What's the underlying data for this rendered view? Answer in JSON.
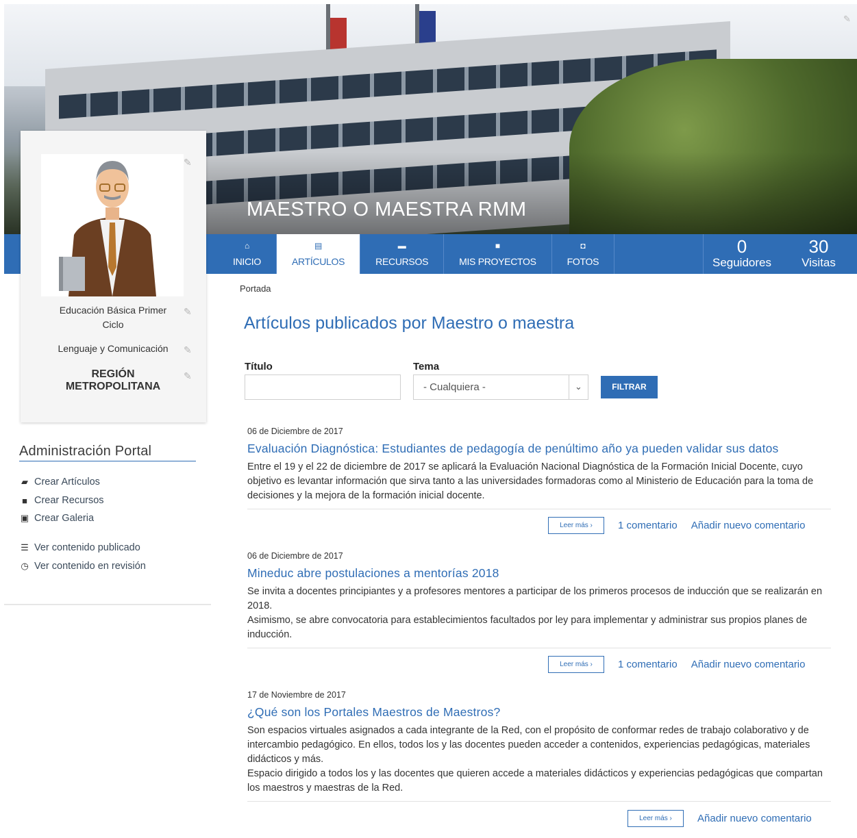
{
  "banner": {
    "title": "MAESTRO O MAESTRA RMM"
  },
  "nav": {
    "tabs": [
      {
        "label": "INICIO",
        "icon": "home-icon",
        "glyph": "⌂"
      },
      {
        "label": "ARTÍCULOS",
        "icon": "article-icon",
        "glyph": "▤"
      },
      {
        "label": "RECURSOS",
        "icon": "briefcase-icon",
        "glyph": "▬"
      },
      {
        "label": "MIS PROYECTOS",
        "icon": "folder-icon",
        "glyph": "■"
      },
      {
        "label": "FOTOS",
        "icon": "camera-icon",
        "glyph": "◘"
      }
    ],
    "stats": [
      {
        "value": "0",
        "label": "Seguidores"
      },
      {
        "value": "30",
        "label": "Visitas"
      }
    ]
  },
  "profile": {
    "level": "Educación Básica Primer Ciclo",
    "subject": "Lenguaje y Comunicación",
    "region": "REGIÓN METROPOLITANA"
  },
  "admin": {
    "title": "Administración Portal",
    "links": [
      {
        "label": "Crear Artículos",
        "glyph": "▰",
        "icon": "book-icon"
      },
      {
        "label": "Crear Recursos",
        "glyph": "■",
        "icon": "resource-icon"
      },
      {
        "label": "Crear Galeria",
        "glyph": "▣",
        "icon": "image-icon"
      },
      {
        "label": "Ver contenido publicado",
        "glyph": "☰",
        "icon": "list-icon"
      },
      {
        "label": "Ver contenido en revisión",
        "glyph": "◷",
        "icon": "clock-icon"
      }
    ]
  },
  "breadcrumb": "Portada",
  "page_title": "Artículos publicados por Maestro o maestra",
  "filters": {
    "title_label": "Título",
    "topic_label": "Tema",
    "topic_value": "- Cualquiera -",
    "button": "FILTRAR"
  },
  "articles": [
    {
      "date": "06 de Diciembre de 2017",
      "title": "Evaluación Diagnóstica: Estudiantes de pedagogía de penúltimo año ya pueden validar sus datos",
      "body": [
        "Entre el 19 y el 22 de diciembre de 2017 se aplicará la Evaluación Nacional Diagnóstica de la Formación Inicial Docente, cuyo objetivo es levantar información que sirva tanto a las universidades formadoras como al Ministerio de Educación para la toma de decisiones y la mejora de la formación inicial docente."
      ],
      "read_more": "Leer más  ›",
      "comments": "1 comentario",
      "add_comment": "Añadir nuevo comentario"
    },
    {
      "date": "06 de Diciembre de 2017",
      "title": "Mineduc abre postulaciones a mentorías 2018",
      "body": [
        "Se invita a docentes principiantes y a profesores mentores a participar de los primeros procesos de inducción que se realizarán en 2018.",
        "Asimismo, se abre convocatoria para establecimientos facultados por ley para implementar y administrar sus propios planes de inducción."
      ],
      "read_more": "Leer más  ›",
      "comments": "1 comentario",
      "add_comment": "Añadir nuevo comentario"
    },
    {
      "date": "17 de Noviembre de 2017",
      "title": "¿Qué son los Portales Maestros de Maestros?",
      "body": [
        "Son espacios virtuales asignados a cada integrante de la Red, con el propósito de conformar redes de trabajo colaborativo y de intercambio pedagógico. En ellos, todos los y las docentes pueden acceder a contenidos, experiencias pedagógicas, materiales didácticos y más.",
        "Espacio dirigido a todos los y las docentes que quieren accede a materiales didácticos y experiencias pedagógicas que compartan los maestros y maestras de la Red."
      ],
      "read_more": "Leer más  ›",
      "comments": "",
      "add_comment": "Añadir nuevo comentario"
    }
  ],
  "colors": {
    "brand": "#2f6db5",
    "nav_bg": "#2f6db5",
    "panel_bg": "#f5f5f5"
  }
}
